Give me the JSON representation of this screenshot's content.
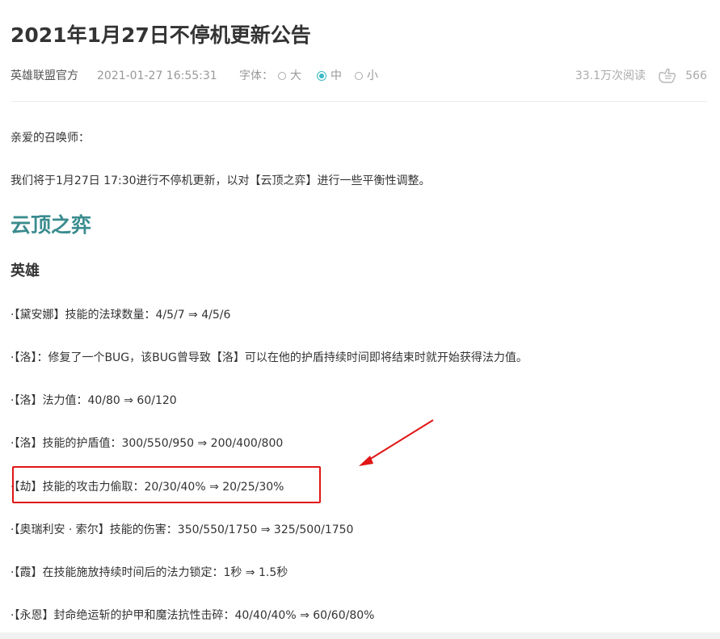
{
  "article": {
    "title": "2021年1月27日不停机更新公告",
    "author": "英雄联盟官方",
    "date": "2021-01-27 16:55:31",
    "font_label": "字体：",
    "font_options": [
      "大",
      "中",
      "小"
    ],
    "font_selected": "中",
    "views": "33.1万次阅读",
    "likes": "566"
  },
  "body": {
    "greeting": "亲爱的召唤师：",
    "intro": "我们将于1月27日 17:30进行不停机更新，以对【云顶之弈】进行一些平衡性调整。",
    "game_heading": "云顶之弈",
    "section_heading": "英雄",
    "items": [
      "·【黛安娜】技能的法球数量：4/5/7 ⇒ 4/5/6",
      "·【洛】：修复了一个BUG，该BUG曾导致【洛】可以在他的护盾持续时间即将结束时就开始获得法力值。",
      "·【洛】法力值：40/80 ⇒ 60/120",
      "·【洛】技能的护盾值：300/550/950 ⇒ 200/400/800",
      "·【劫】技能的攻击力偷取：20/30/40% ⇒ 20/25/30%",
      "·【奥瑞利安 · 索尔】技能的伤害：350/550/1750 ⇒ 325/500/1750",
      "·【霞】在技能施放持续时间后的法力锁定：1秒 ⇒ 1.5秒",
      "·【永恩】封命绝运斩的护甲和魔法抗性击碎：40/40/40% ⇒ 60/60/80%"
    ]
  },
  "annotation": {
    "color": "#e01515",
    "highlighted_item": 4
  },
  "colors": {
    "accent": "#3ab9c6",
    "game_heading": "#3a8c8f"
  }
}
